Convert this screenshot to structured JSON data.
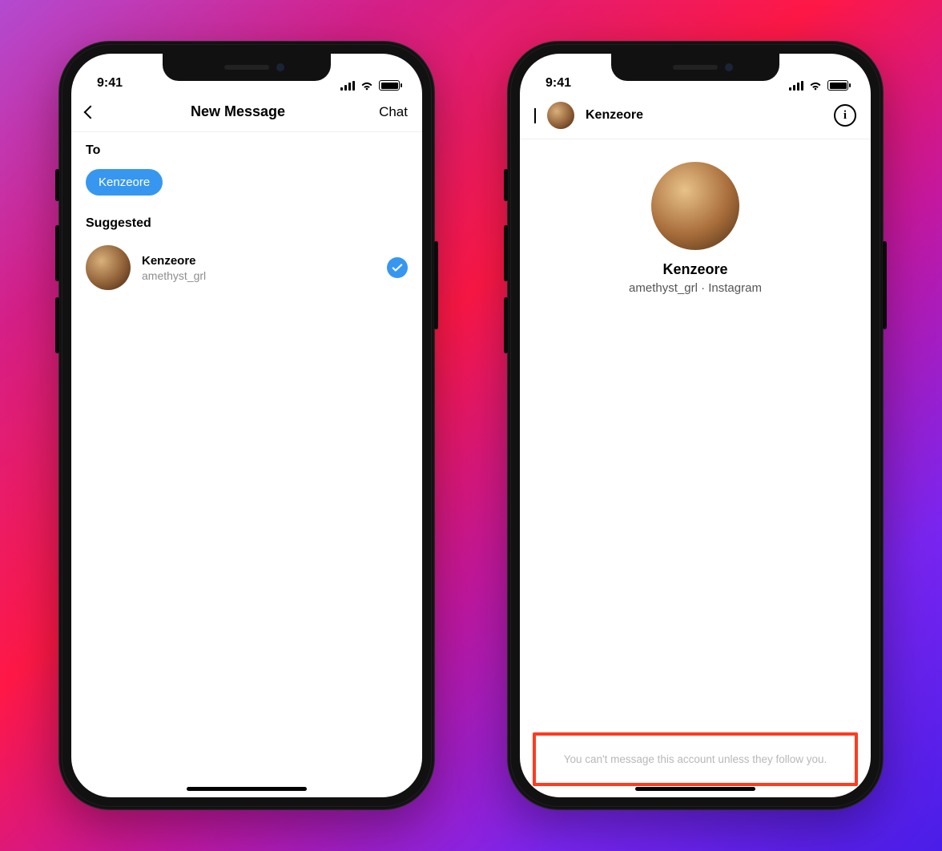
{
  "status": {
    "time": "9:41"
  },
  "left": {
    "nav": {
      "title": "New Message",
      "action": "Chat"
    },
    "to_label": "To",
    "chip": "Kenzeore",
    "suggested_label": "Suggested",
    "suggested": {
      "name": "Kenzeore",
      "username": "amethyst_grl",
      "selected": true
    }
  },
  "right": {
    "nav": {
      "username": "Kenzeore"
    },
    "profile": {
      "name": "Kenzeore",
      "subtitle": "amethyst_grl · Instagram"
    },
    "restriction_text": "You can't message this account unless they follow you."
  }
}
